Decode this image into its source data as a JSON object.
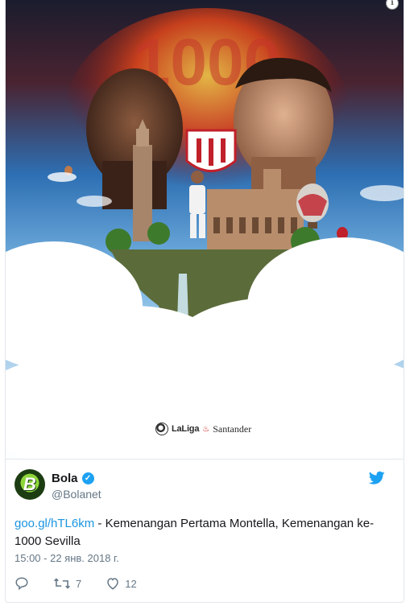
{
  "media": {
    "number_text": "1000",
    "logo_brand": "LaLiga",
    "logo_sponsor": "Santander",
    "info_glyph": "i"
  },
  "tweet": {
    "avatar_letter": "B",
    "display_name": "Bola",
    "handle": "@Bolanet",
    "link_text": "goo.gl/hTL6km",
    "text": " - Kemenangan Pertama Montella, Kemenangan ke-1000 Sevilla",
    "timestamp": "15:00 - 22 янв. 2018 г.",
    "retweets": "7",
    "likes": "12",
    "verified_glyph": "✓"
  },
  "icons": [
    "info-icon",
    "verified-badge-icon",
    "twitter-bird-icon",
    "reply-icon",
    "retweet-icon",
    "like-heart-icon",
    "laliga-ball-icon"
  ],
  "colors": {
    "link": "#1b95e0",
    "verified": "#1da1f2",
    "muted": "#657786",
    "text": "#14171a",
    "sky": "#2f7fc1",
    "flame": "#e2451a"
  }
}
